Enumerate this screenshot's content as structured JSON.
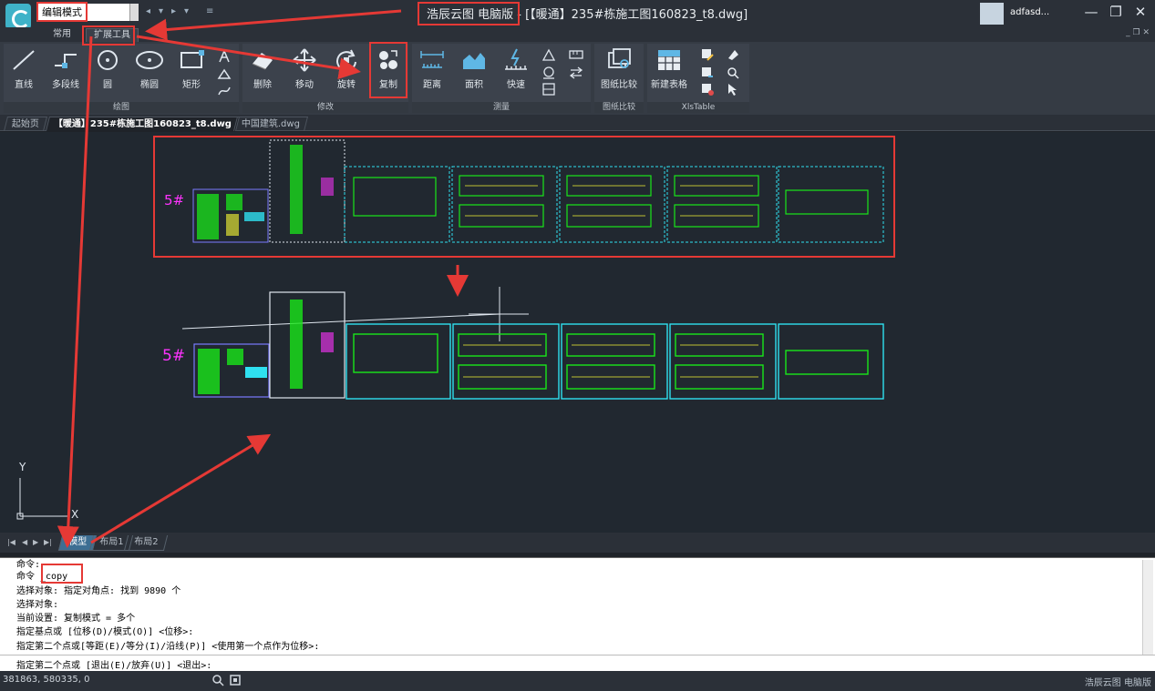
{
  "titlebar": {
    "mode_value": "编辑模式",
    "app_title": "浩辰云图 电脑版 - [【暖通】235#栋施工图160823_t8.dwg]",
    "user_name": "adfasd..."
  },
  "ribbon_tabs": [
    "常用",
    "扩展工具"
  ],
  "ribbon_groups": [
    {
      "label": "绘图",
      "tools": [
        "直线",
        "多段线",
        "圆",
        "椭圆",
        "矩形"
      ]
    },
    {
      "label": "修改",
      "tools": [
        "删除",
        "移动",
        "旋转",
        "复制"
      ]
    },
    {
      "label": "测量",
      "tools": [
        "距离",
        "面积",
        "快速"
      ]
    },
    {
      "label": "图纸比较",
      "tools": [
        "图纸比较"
      ]
    },
    {
      "label": "XlsTable",
      "tools": [
        "新建表格"
      ]
    }
  ],
  "doc_tabs": [
    "起始页",
    "【暖通】235#栋施工图160823_t8.dwg",
    "中国建筑.dwg"
  ],
  "canvas": {
    "building_label_top": "5#",
    "building_label_bottom": "5#",
    "axis_y": "Y",
    "axis_x": "X"
  },
  "layout_tabs": [
    "模型",
    "布局1",
    "布局2"
  ],
  "command_lines": [
    "命令:",
    "命令 _copy",
    "选择对象: 指定对角点: 找到 9890 个",
    "选择对象:",
    "当前设置:  复制模式 = 多个",
    "指定基点或 [位移(D)/模式(O)] <位移>:",
    "指定第二个点或[等距(E)/等分(I)/沿线(P)] <使用第一个点作为位移>:"
  ],
  "command_prompt": "指定第二个点或 [退出(E)/放弃(U)] <退出>:",
  "status": {
    "coords": "381863, 580335, 0",
    "brand": "浩辰云图 电脑版"
  },
  "colors": {
    "cad_bg": "#212830",
    "annotation": "#e53935",
    "cyan": "#2fe0f0",
    "green": "#19e619",
    "magenta": "#ff33ff"
  }
}
